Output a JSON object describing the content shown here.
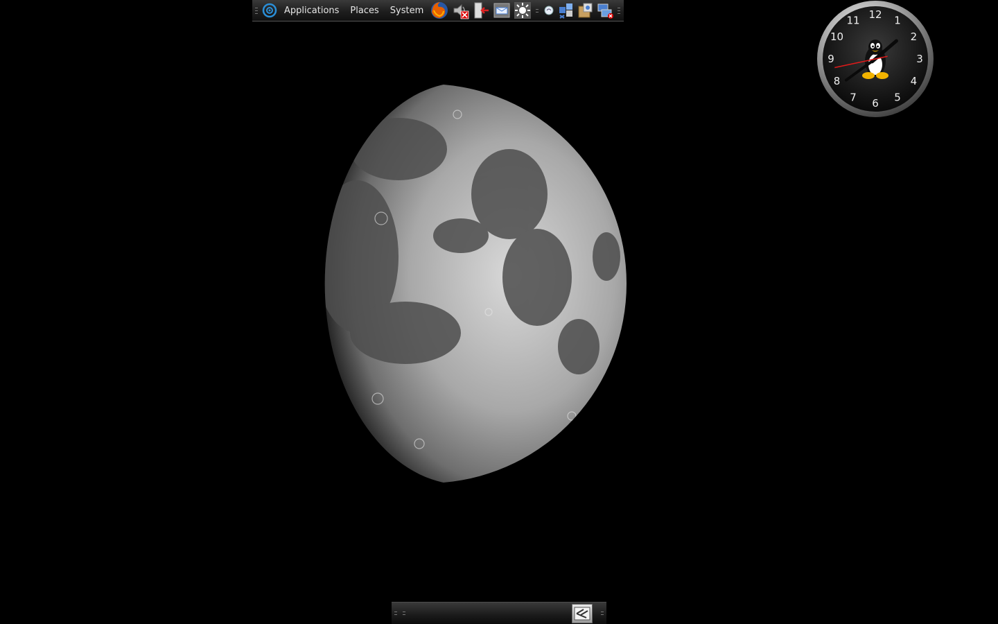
{
  "top_panel": {
    "menus": {
      "applications": "Applications",
      "places": "Places",
      "system": "System"
    },
    "launchers": [
      {
        "icon": "firefox-icon"
      },
      {
        "icon": "volume-muted-icon"
      },
      {
        "icon": "logout-icon"
      },
      {
        "icon": "mail-icon"
      },
      {
        "icon": "brightness-icon"
      },
      {
        "icon": "network-icon"
      },
      {
        "icon": "puzzle-applet-icon"
      },
      {
        "icon": "package-manager-icon"
      },
      {
        "icon": "network-disconnected-icon"
      }
    ]
  },
  "clock": {
    "numerals": [
      "12",
      "1",
      "2",
      "3",
      "4",
      "5",
      "6",
      "7",
      "8",
      "9",
      "10",
      "11"
    ],
    "time": {
      "hour": 1,
      "minute": 39,
      "second": 41
    }
  },
  "wallpaper": {
    "subject": "moon-icon"
  },
  "bottom_panel": {
    "show_desktop_icon": "show-desktop-icon"
  },
  "colors": {
    "accent": "#2a8fd8",
    "second_hand": "#e01a1a",
    "panel": "#1e1e1e"
  }
}
